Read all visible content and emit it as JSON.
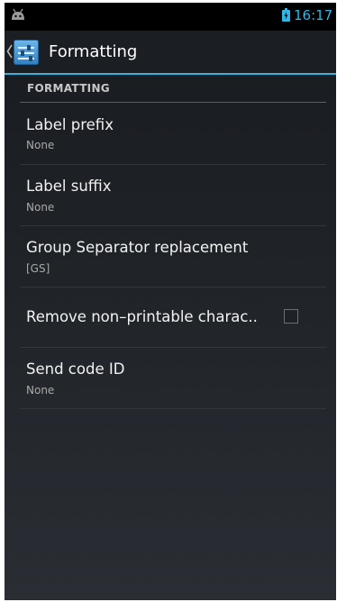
{
  "status_bar": {
    "time": "16:17"
  },
  "action_bar": {
    "title": "Formatting"
  },
  "section": {
    "header": "FORMATTING"
  },
  "preferences": [
    {
      "title": "Label prefix",
      "summary": "None"
    },
    {
      "title": "Label suffix",
      "summary": "None"
    },
    {
      "title": "Group Separator replacement",
      "summary": "[GS]"
    },
    {
      "title": "Remove non–printable charac..",
      "checked": false
    },
    {
      "title": "Send code ID",
      "summary": "None"
    }
  ],
  "colors": {
    "accent": "#33b5e5"
  }
}
